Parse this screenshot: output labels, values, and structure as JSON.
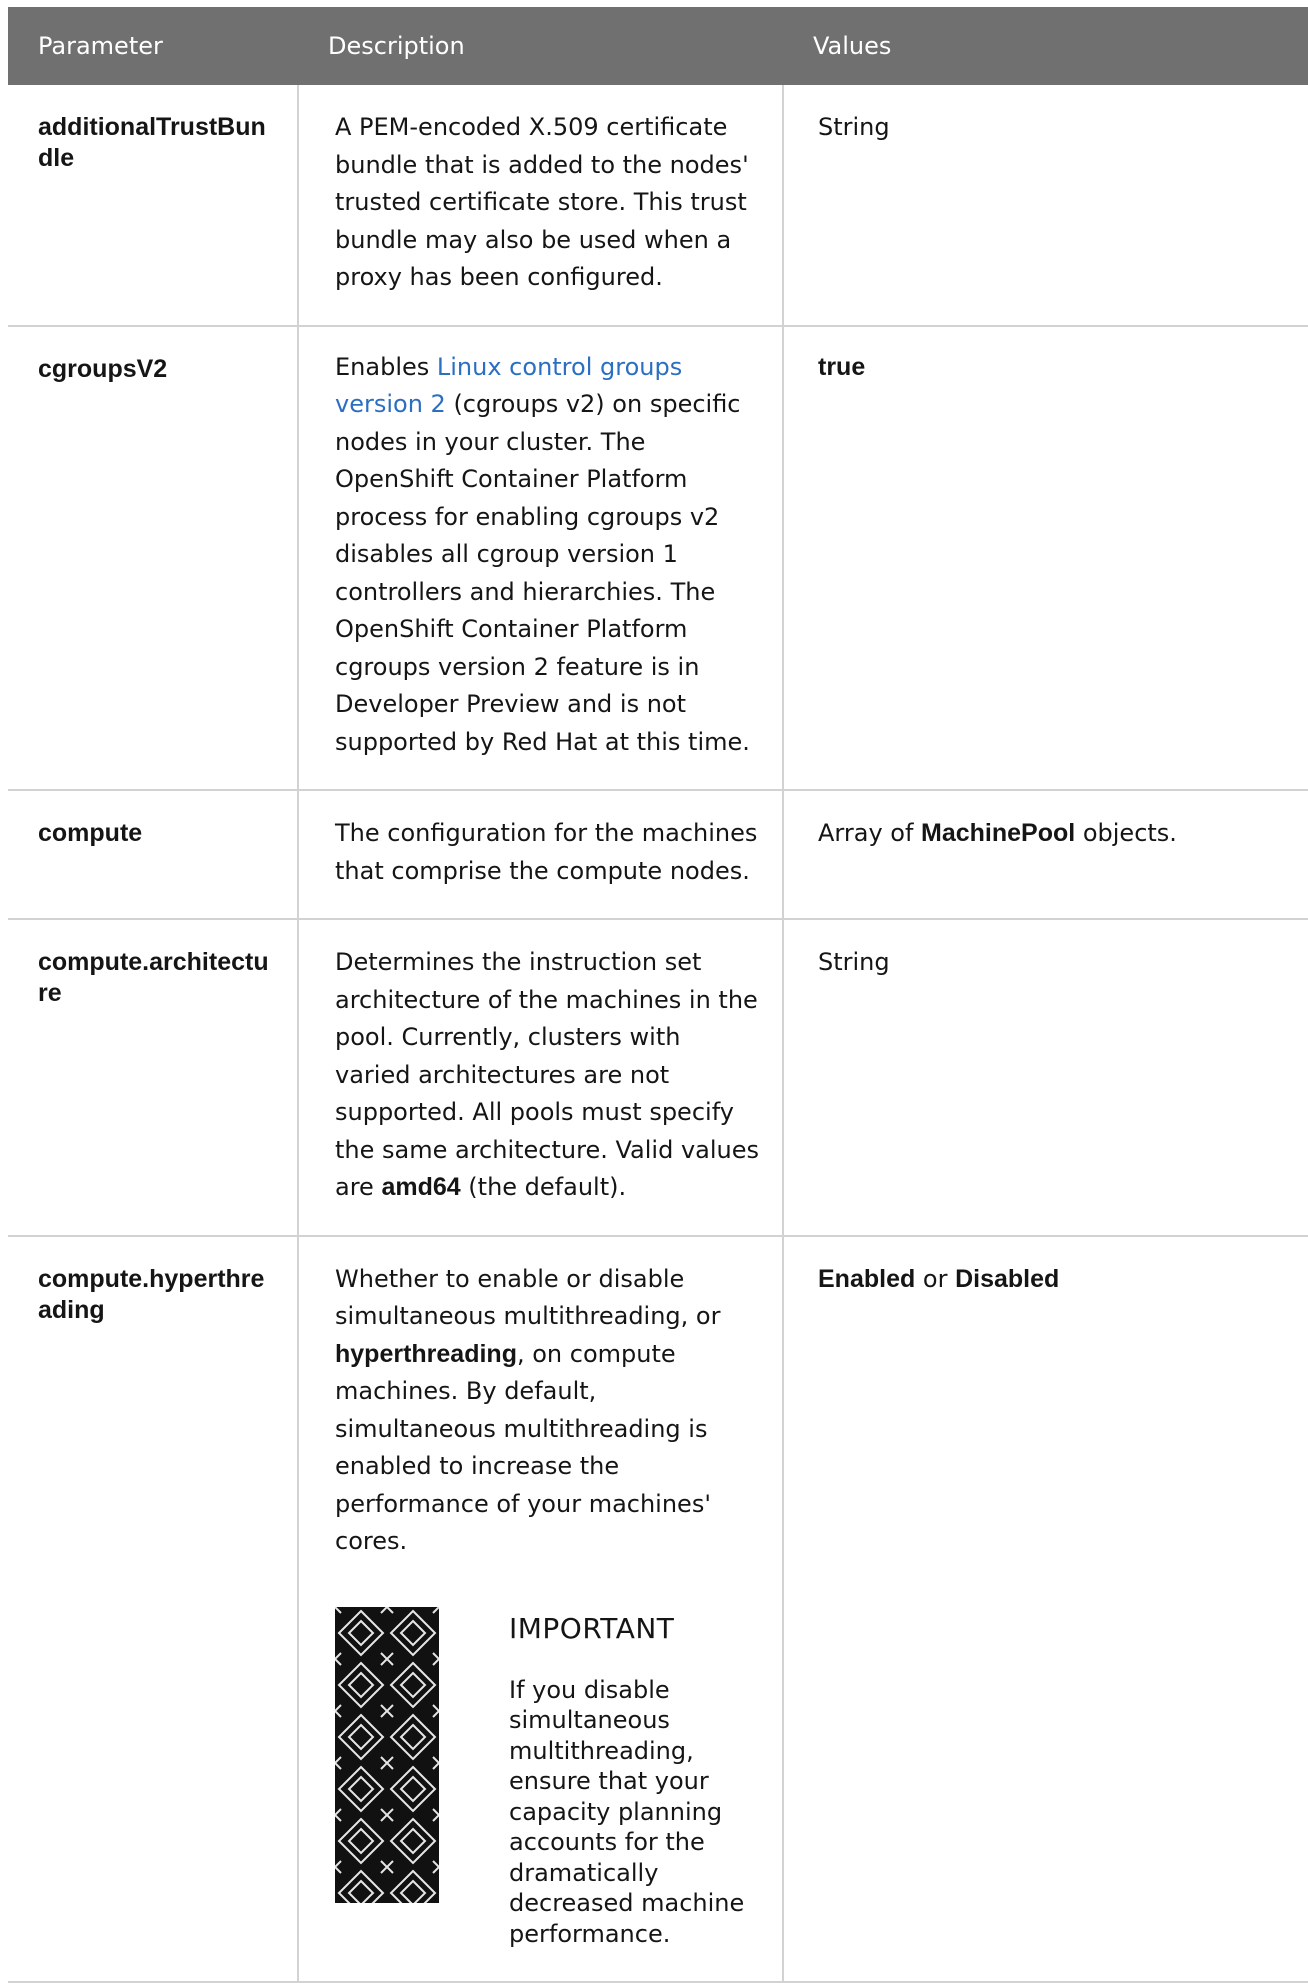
{
  "header": {
    "col_parameter": "Parameter",
    "col_description": "Description",
    "col_values": "Values"
  },
  "rows": [
    {
      "parameter": "additionalTrustBundle",
      "description": "A PEM-encoded X.509 certificate bundle that is added to the nodes' trusted certificate store. This trust bundle may also be used when a proxy has been configured.",
      "value": "String"
    },
    {
      "parameter": "cgroupsV2",
      "description_prefix": "Enables ",
      "description_link": "Linux control groups version 2",
      "description_suffix": " (cgroups v2) on specific nodes in your cluster. The OpenShift Container Platform process for enabling cgroups v2 disables all cgroup version 1 controllers and hierarchies. The OpenShift Container Platform cgroups version 2 feature is in Developer Preview and is not supported by Red Hat at this time.",
      "value": "true"
    },
    {
      "parameter": "compute",
      "description": "The configuration for the machines that comprise the compute nodes.",
      "value_prefix": "Array of ",
      "value_strong": "MachinePool",
      "value_suffix": " objects."
    },
    {
      "parameter": "compute.architecture",
      "description_prefix": "Determines the instruction set architecture of the machines in the pool. Currently, clusters with varied architectures are not supported. All pools must specify the same architecture. Valid values are ",
      "description_strong": "amd64",
      "description_suffix": " (the default).",
      "value": "String"
    },
    {
      "parameter": "compute.hyperthreading",
      "description_prefix": "Whether to enable or disable simultaneous multithreading, or ",
      "description_strong": "hyperthreading",
      "description_suffix": ", on compute machines. By default, simultaneous multithreading is enabled to increase the performance of your machines' cores.",
      "value_a": "Enabled",
      "value_or": " or ",
      "value_b": "Disabled",
      "admonition": {
        "title": "IMPORTANT",
        "text": "If you disable simultaneous multithreading, ensure that your capacity planning accounts for the dramatically decreased machine performance.",
        "icon": "important-pattern-icon"
      }
    }
  ]
}
